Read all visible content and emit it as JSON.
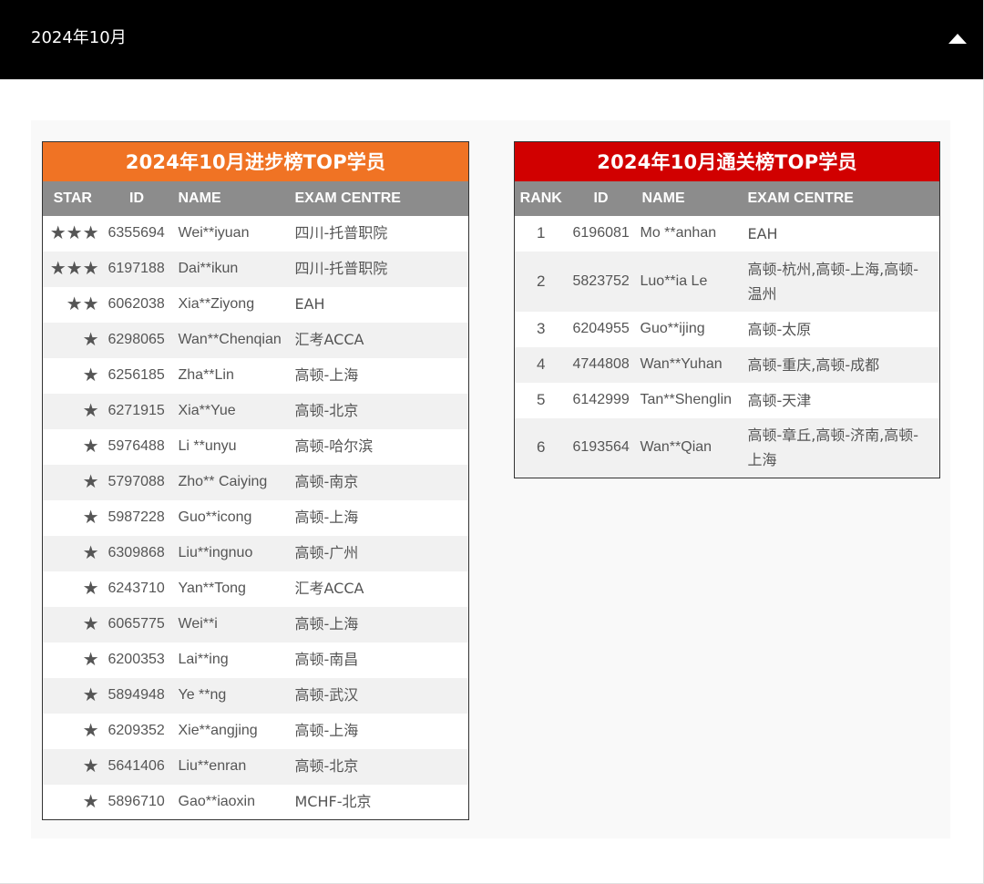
{
  "accordion": {
    "title": "2024年10月",
    "toggle_icon": "caret-up-icon"
  },
  "colors": {
    "header_bg": "#000000",
    "progress_title_bg": "#f07324",
    "pass_title_bg": "#d10000",
    "column_header_bg": "#8c8c8c"
  },
  "progress_board": {
    "title": "2024年10月进步榜TOP学员",
    "columns": [
      "STAR",
      "ID",
      "NAME",
      "EXAM CENTRE"
    ],
    "rows": [
      {
        "star": "★★★",
        "id": "6355694",
        "name": "Wei**iyuan",
        "centre": "四川-托普职院"
      },
      {
        "star": "★★★",
        "id": "6197188",
        "name": "Dai**ikun",
        "centre": "四川-托普职院"
      },
      {
        "star": "★★",
        "id": "6062038",
        "name": "Xia**Ziyong",
        "centre": "EAH"
      },
      {
        "star": "★",
        "id": "6298065",
        "name": "Wan**Chenqian",
        "centre": "汇考ACCA"
      },
      {
        "star": "★",
        "id": "6256185",
        "name": "Zha**Lin",
        "centre": "高顿-上海"
      },
      {
        "star": "★",
        "id": "6271915",
        "name": "Xia**Yue",
        "centre": "高顿-北京"
      },
      {
        "star": "★",
        "id": "5976488",
        "name": "Li **unyu",
        "centre": "高顿-哈尔滨"
      },
      {
        "star": "★",
        "id": "5797088",
        "name": "Zho** Caiying",
        "centre": "高顿-南京"
      },
      {
        "star": "★",
        "id": "5987228",
        "name": "Guo**icong",
        "centre": "高顿-上海"
      },
      {
        "star": "★",
        "id": "6309868",
        "name": "Liu**ingnuo",
        "centre": "高顿-广州"
      },
      {
        "star": "★",
        "id": "6243710",
        "name": "Yan**Tong",
        "centre": "汇考ACCA"
      },
      {
        "star": "★",
        "id": "6065775",
        "name": "Wei**i",
        "centre": "高顿-上海"
      },
      {
        "star": "★",
        "id": "6200353",
        "name": "Lai**ing",
        "centre": "高顿-南昌"
      },
      {
        "star": "★",
        "id": "5894948",
        "name": "Ye **ng",
        "centre": "高顿-武汉"
      },
      {
        "star": "★",
        "id": "6209352",
        "name": "Xie**angjing",
        "centre": "高顿-上海"
      },
      {
        "star": "★",
        "id": "5641406",
        "name": "Liu**enran",
        "centre": "高顿-北京"
      },
      {
        "star": "★",
        "id": "5896710",
        "name": "Gao**iaoxin",
        "centre": "MCHF-北京"
      }
    ]
  },
  "pass_board": {
    "title": "2024年10月通关榜TOP学员",
    "columns": [
      "RANK",
      "ID",
      "NAME",
      "EXAM CENTRE"
    ],
    "rows": [
      {
        "rank": "1",
        "id": "6196081",
        "name": "Mo **anhan",
        "centre": "EAH"
      },
      {
        "rank": "2",
        "id": "5823752",
        "name": "Luo**ia Le",
        "centre": "高顿-杭州,高顿-上海,高顿-温州"
      },
      {
        "rank": "3",
        "id": "6204955",
        "name": "Guo**ijing",
        "centre": "高顿-太原"
      },
      {
        "rank": "4",
        "id": "4744808",
        "name": "Wan**Yuhan",
        "centre": "高顿-重庆,高顿-成都"
      },
      {
        "rank": "5",
        "id": "6142999",
        "name": "Tan**Shenglin",
        "centre": "高顿-天津"
      },
      {
        "rank": "6",
        "id": "6193564",
        "name": "Wan**Qian",
        "centre": "高顿-章丘,高顿-济南,高顿-上海"
      }
    ]
  }
}
